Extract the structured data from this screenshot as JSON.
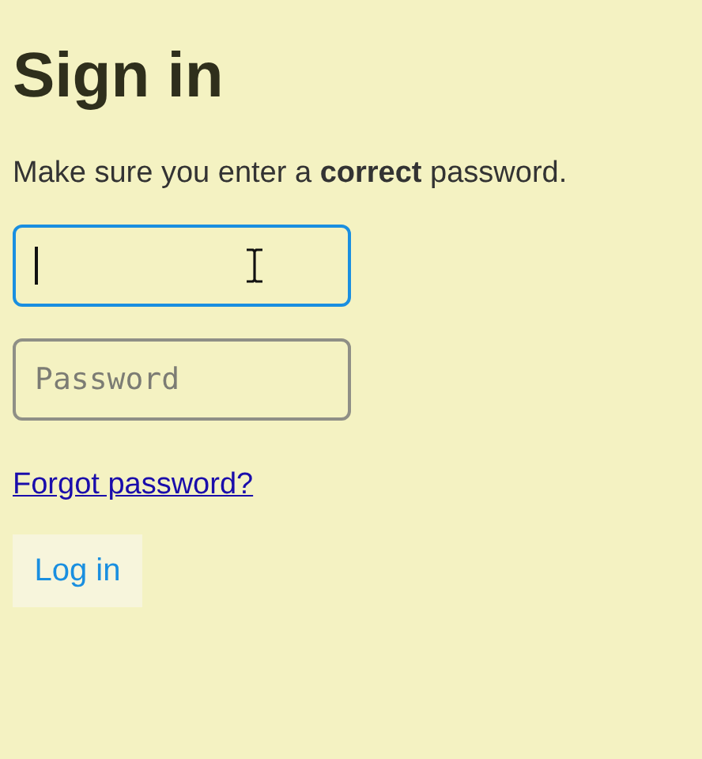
{
  "heading": "Sign in",
  "intro": "Make sure you enter a **correct** password.",
  "fields": [
    {
      "focused": true
    },
    {
      "placeholder": "Password",
      "focused": false
    }
  ],
  "link": "Forgot password?",
  "button": "Log in"
}
